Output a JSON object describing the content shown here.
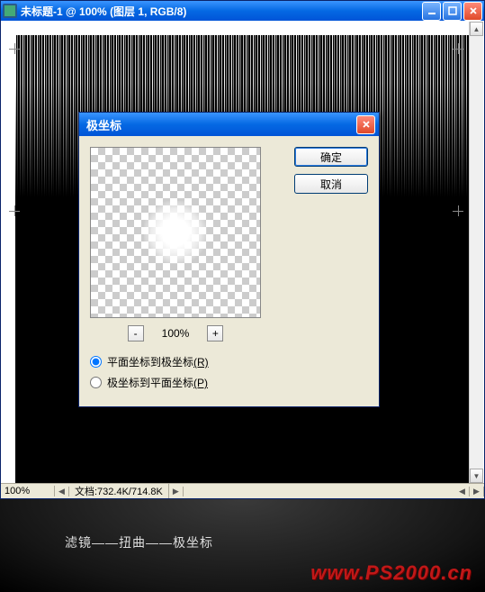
{
  "window": {
    "title": "未标题-1 @ 100% (图层 1, RGB/8)"
  },
  "statusbar": {
    "zoom": "100%",
    "doc": "文档:732.4K/714.8K"
  },
  "dialog": {
    "title": "极坐标",
    "ok": "确定",
    "cancel": "取消",
    "zoom_minus": "-",
    "zoom_plus": "+",
    "zoom_value": "100%",
    "radio1_label": "平面坐标到极坐标",
    "radio1_key": "(R)",
    "radio2_label": "极坐标到平面坐标",
    "radio2_key": "(P)"
  },
  "caption": "滤镜——扭曲——极坐标",
  "watermark": "www.PS2000.cn"
}
